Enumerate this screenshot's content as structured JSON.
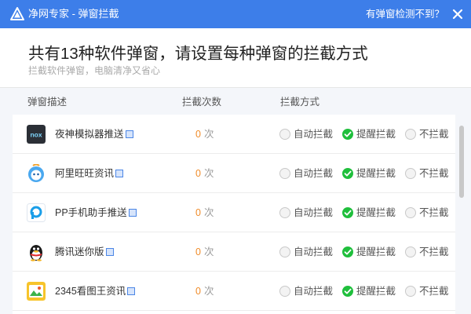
{
  "window": {
    "title": "净网专家 - 弹窗拦截",
    "help_link": "有弹窗检测不到？",
    "accent_color": "#3d7ee9"
  },
  "header": {
    "heading": "共有13种软件弹窗，请设置每种弹窗的拦截方式",
    "subheading": "拦截软件弹窗，电脑清净又省心"
  },
  "columns": {
    "description": "弹窗描述",
    "count": "拦截次数",
    "mode": "拦截方式"
  },
  "options": {
    "auto": "自动拦截",
    "remind": "提醒拦截",
    "none": "不拦截"
  },
  "rows": [
    {
      "name": "夜神模拟器推送",
      "icon": "nox-icon",
      "count": "0",
      "unit": "次",
      "selected": "remind"
    },
    {
      "name": "阿里旺旺资讯",
      "icon": "aliwangwang-icon",
      "count": "0",
      "unit": "次",
      "selected": "remind"
    },
    {
      "name": "PP手机助手推送",
      "icon": "pp-assistant-icon",
      "count": "0",
      "unit": "次",
      "selected": "remind"
    },
    {
      "name": "腾讯迷你版",
      "icon": "qq-penguin-icon",
      "count": "0",
      "unit": "次",
      "selected": "remind"
    },
    {
      "name": "2345看图王资讯",
      "icon": "2345-viewer-icon",
      "count": "0",
      "unit": "次",
      "selected": "remind"
    }
  ],
  "colors": {
    "count_number": "#f08c2a",
    "selected_radio": "#1fbf3c",
    "info_icon": "#4b86e6"
  }
}
